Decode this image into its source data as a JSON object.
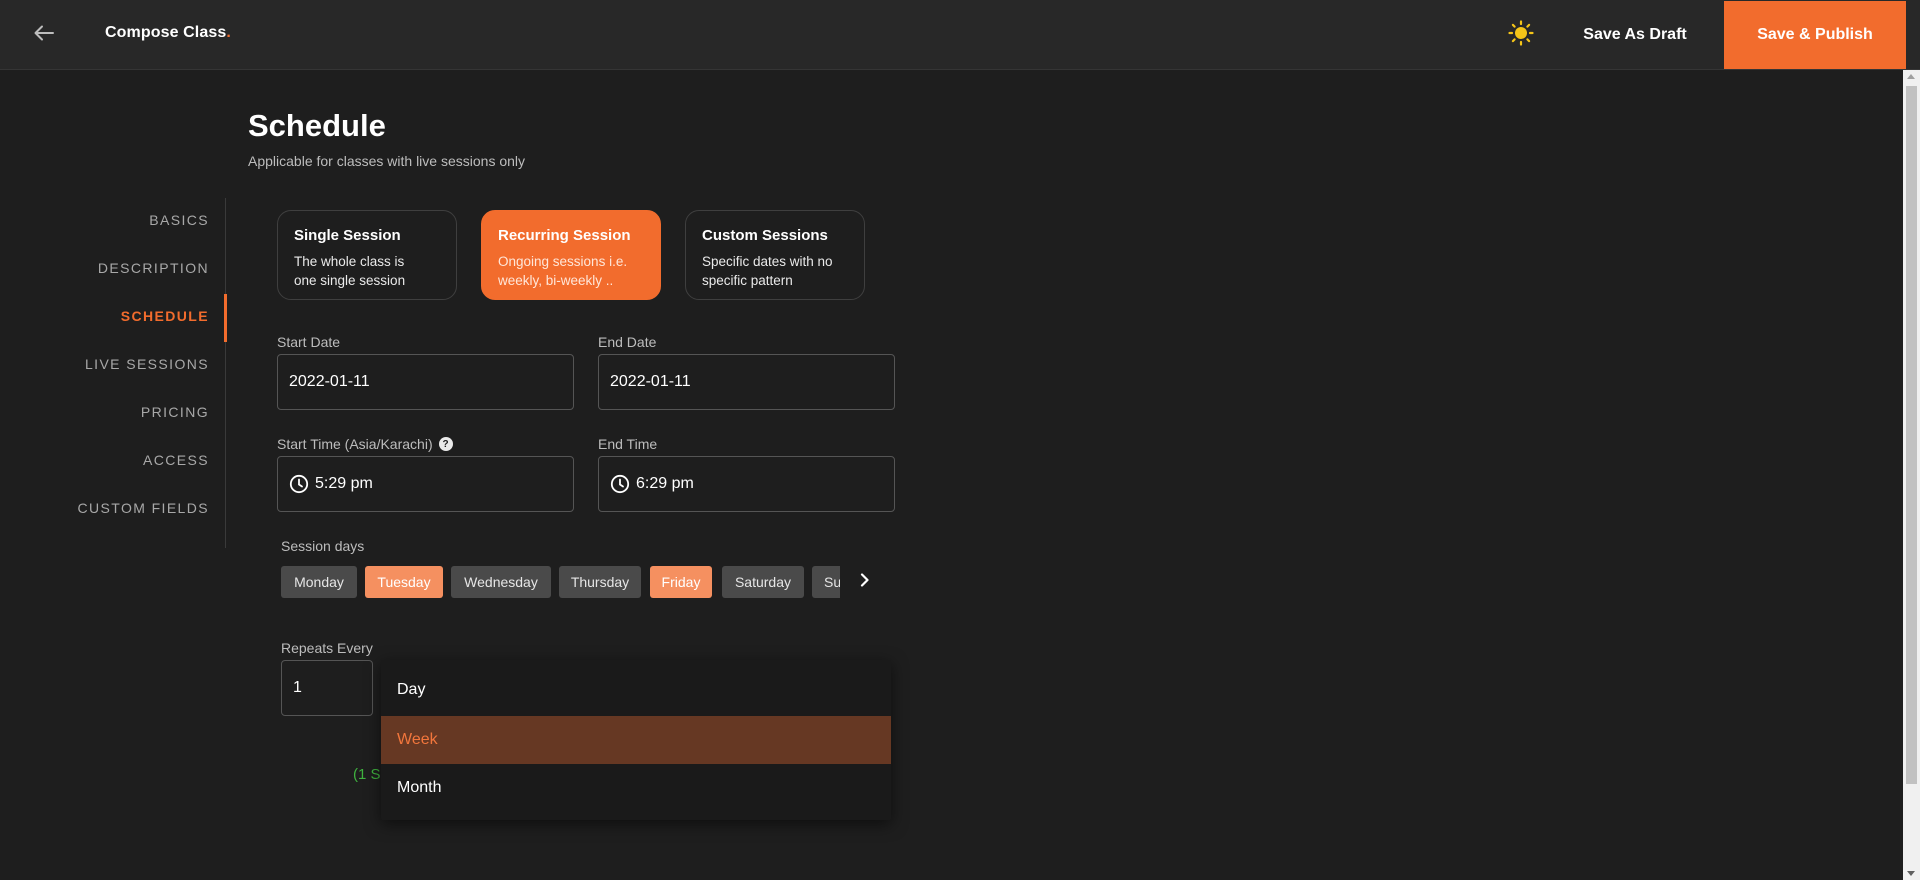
{
  "header": {
    "title": "Compose Class",
    "title_dot": ".",
    "save_draft_label": "Save As Draft",
    "save_publish_label": "Save & Publish",
    "accent_color": "#f26c2d",
    "back_icon": "arrow-left-icon",
    "theme_icon": "sun-icon"
  },
  "sidebar": {
    "items": [
      {
        "label": "BASICS"
      },
      {
        "label": "DESCRIPTION"
      },
      {
        "label": "SCHEDULE",
        "active": true
      },
      {
        "label": "LIVE SESSIONS"
      },
      {
        "label": "PRICING"
      },
      {
        "label": "ACCESS"
      },
      {
        "label": "CUSTOM FIELDS"
      }
    ]
  },
  "schedule": {
    "title": "Schedule",
    "subtitle": "Applicable for classes with live sessions only",
    "session_types": [
      {
        "title": "Single Session",
        "desc_line1": "The whole class is",
        "desc_line2": "one single session",
        "active": false
      },
      {
        "title": "Recurring Session",
        "desc_line1": "Ongoing sessions i.e.",
        "desc_line2": "weekly, bi-weekly ..",
        "active": true
      },
      {
        "title": "Custom Sessions",
        "desc_line1": "Specific dates with no",
        "desc_line2": "specific pattern",
        "active": false
      }
    ],
    "start_date": {
      "label": "Start Date",
      "value": "2022-01-11"
    },
    "end_date": {
      "label": "End Date",
      "value": "2022-01-11"
    },
    "start_time": {
      "label": "Start Time (Asia/Karachi)",
      "value": "5:29 pm",
      "help": "?"
    },
    "end_time": {
      "label": "End Time",
      "value": "6:29 pm"
    },
    "session_days": {
      "label": "Session days",
      "days": [
        {
          "label": "Monday",
          "selected": false
        },
        {
          "label": "Tuesday",
          "selected": true
        },
        {
          "label": "Wednesday",
          "selected": false
        },
        {
          "label": "Thursday",
          "selected": false
        },
        {
          "label": "Friday",
          "selected": true
        },
        {
          "label": "Saturday",
          "selected": false
        },
        {
          "label": "Sunday",
          "selected": false
        }
      ]
    },
    "repeats_every": {
      "label": "Repeats Every",
      "value": "1"
    },
    "frequency_options": [
      {
        "label": "Day",
        "selected": false
      },
      {
        "label": "Week",
        "selected": true
      },
      {
        "label": "Month",
        "selected": false
      }
    ],
    "summary_partial": "(1 S"
  }
}
